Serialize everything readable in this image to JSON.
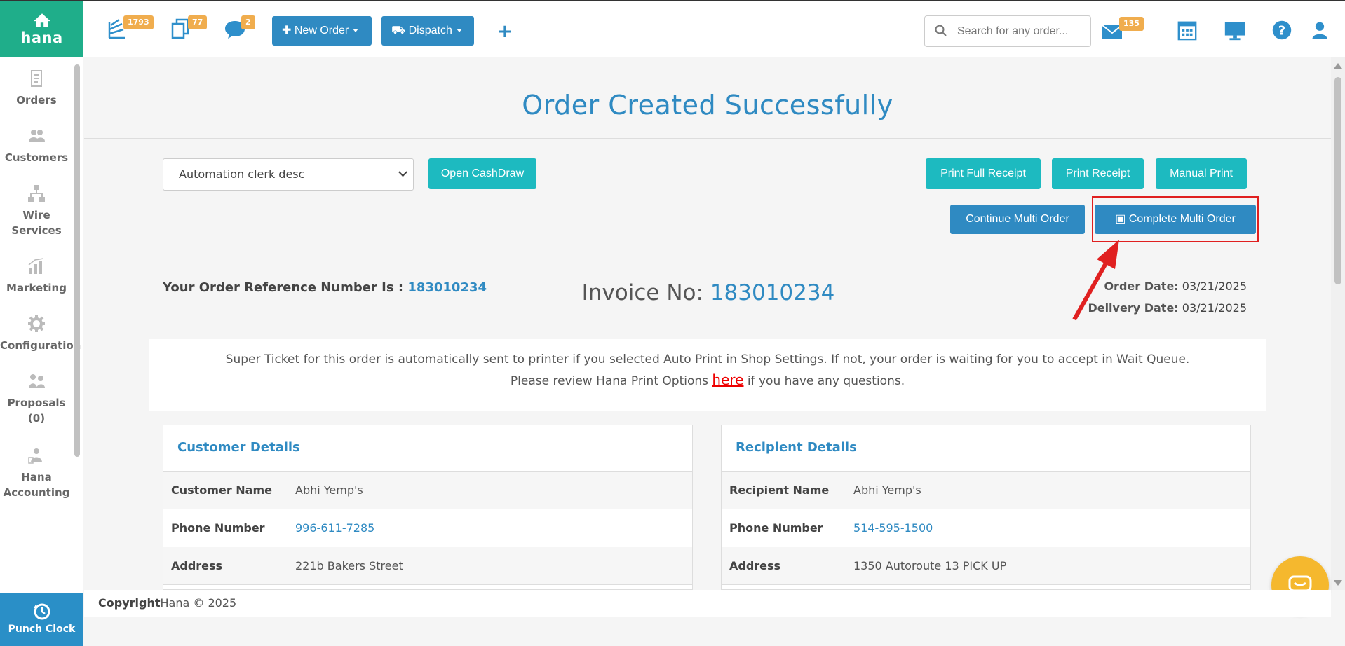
{
  "app": {
    "logo_text": "hana"
  },
  "topbar": {
    "badges": {
      "orders": "1793",
      "tickets": "77",
      "messages": "2",
      "mail": "135"
    },
    "new_order_label": "New Order",
    "dispatch_label": "Dispatch",
    "add_label": "+",
    "search_placeholder": "Search for any order..."
  },
  "sidebar": {
    "items": [
      {
        "label": "Orders"
      },
      {
        "label": "Customers"
      },
      {
        "label": "Wire Services"
      },
      {
        "label": "Marketing"
      },
      {
        "label": "Configuration"
      },
      {
        "label": "Proposals (0)"
      },
      {
        "label": "Hana Accounting"
      }
    ],
    "punch_label": "Punch Clock"
  },
  "main": {
    "title": "Order Created Successfully",
    "clerk_select": "Automation clerk desc",
    "buttons": {
      "open_cashdraw": "Open CashDraw",
      "print_full_receipt": "Print Full Receipt",
      "print_receipt": "Print Receipt",
      "manual_print": "Manual Print",
      "continue_multi": "Continue Multi Order",
      "complete_multi": "Complete Multi Order"
    },
    "ref_label": "Your Order Reference Number Is :",
    "ref_number": "183010234",
    "invoice_label": "Invoice No:",
    "invoice_number": "183010234",
    "order_date_label": "Order Date:",
    "order_date": "03/21/2025",
    "delivery_date_label": "Delivery Date:",
    "delivery_date": "03/21/2025",
    "notice_line1": "Super Ticket for this order is automatically sent to printer if you selected Auto Print in Shop Settings. If not, your order is waiting for you to accept in Wait Queue.",
    "notice_line2_pre": "Please review Hana Print Options",
    "notice_link": "here",
    "notice_line2_post": "if you have any questions."
  },
  "customer": {
    "heading": "Customer Details",
    "rows": [
      {
        "k": "Customer Name",
        "v": "Abhi Yemp's"
      },
      {
        "k": "Phone Number",
        "v": "996-611-7285"
      },
      {
        "k": "Address",
        "v": "221b Bakers Street"
      }
    ]
  },
  "recipient": {
    "heading": "Recipient Details",
    "rows": [
      {
        "k": "Recipient Name",
        "v": "Abhi Yemp's"
      },
      {
        "k": "Phone Number",
        "v": "514-595-1500"
      },
      {
        "k": "Address",
        "v": "1350 Autoroute 13 PICK UP"
      }
    ]
  },
  "footer": {
    "copyright_label": "Copyright",
    "copyright_text": "Hana © 2025"
  },
  "colors": {
    "accent_blue": "#2f8ac2",
    "teal": "#1dbac0",
    "logo_green": "#1fae8a",
    "badge_orange": "#f0ad4e",
    "highlight_red": "#e02020"
  }
}
